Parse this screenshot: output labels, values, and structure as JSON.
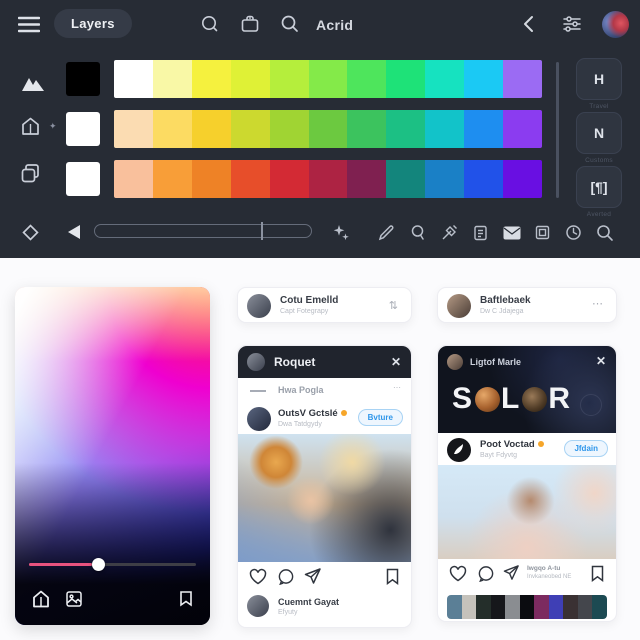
{
  "topbar": {
    "menu_label": "Layers",
    "title": "Acrid",
    "icons": [
      "hamburger-icon",
      "search-circle-icon",
      "briefcase-icon",
      "search-icon",
      "chevron-left-icon",
      "tune-icon",
      "avatar"
    ]
  },
  "left_rail": {
    "icons": [
      "mountains-icon",
      "home-icon",
      "sparkle-icon",
      "copy-icon",
      "diamond-icon"
    ],
    "sparkle_glyph": "✦"
  },
  "palette": {
    "rows": [
      {
        "lead": "#000000",
        "colors": [
          "#ffffff",
          "#f9f8a6",
          "#f5f13e",
          "#dff136",
          "#b5ee3c",
          "#84ea49",
          "#4ee55c",
          "#1ee278",
          "#16e2c0",
          "#1bc9f4",
          "#9b6bf3"
        ]
      },
      {
        "lead": "#ffffff",
        "colors": [
          "#fbdcb2",
          "#fcdb62",
          "#f6d02c",
          "#ccd92f",
          "#a0d433",
          "#6cc940",
          "#3cc35e",
          "#1cc084",
          "#12c3c9",
          "#1e8ef0",
          "#8b3cf0"
        ]
      },
      {
        "lead": "#ffffff",
        "colors": [
          "#f9c09c",
          "#f89e38",
          "#ee8226",
          "#e74e2a",
          "#d32a34",
          "#ad2343",
          "#7f2050",
          "#13857c",
          "#1a80c6",
          "#2152e9",
          "#690fe2"
        ]
      }
    ]
  },
  "right_sidebar": {
    "buttons": [
      {
        "glyph": "H",
        "label": "Travel"
      },
      {
        "glyph": "N",
        "label": "Customs"
      },
      {
        "glyph": "[¶]",
        "label": "Averted"
      }
    ]
  },
  "bottom_toolbar": {
    "slider_value": 77,
    "icons": [
      "play-left-icon",
      "stars-settings-icon",
      "pencil-icon",
      "search-small-icon",
      "pen-icon",
      "clipboard-icon",
      "mail-icon",
      "frame-icon",
      "clock-icon",
      "search-icon"
    ]
  },
  "color_picker": {
    "slider_value": 38,
    "accent": "#e8537f",
    "icons": [
      "home-icon",
      "film-icon",
      "bookmark-icon"
    ]
  },
  "glyphs": {
    "close": "✕",
    "ellipsis": "⋯",
    "sync": "⇅",
    "sparkle": "✦"
  },
  "cards": {
    "mini_left": {
      "name": "Cotu Emelld",
      "subtitle": "Capt Fotegrapy"
    },
    "mini_right": {
      "name": "Baftlebaek",
      "subtitle": "Dw C Jdajega"
    },
    "post_left": {
      "header_title": "Roquet",
      "row_label": "Hwa Pogla",
      "user_name": "OutsV Gctslé",
      "user_subtitle": "Dwa Tatdgydy",
      "button_label": "Bvture",
      "footer_name": "Cuemnt Gayat",
      "footer_subtitle": "Efyuty"
    },
    "post_right": {
      "header_title": "Ligtof Marle",
      "banner_title": "SOLOR",
      "user_name": "Poot Voctad",
      "user_subtitle": "Bayt Fdyvtg",
      "button_label": "Jfdain",
      "meta_line1": "Iwgqo A-tu",
      "meta_line2": "Invkaneobed NE",
      "palette": [
        "#5b7f96",
        "#c5c2bb",
        "#242e2a",
        "#16171b",
        "#8a8d91",
        "#0b0c10",
        "#7c2b60",
        "#3f3fb5",
        "#3a3133",
        "#44464c",
        "#1c4a52"
      ]
    }
  }
}
